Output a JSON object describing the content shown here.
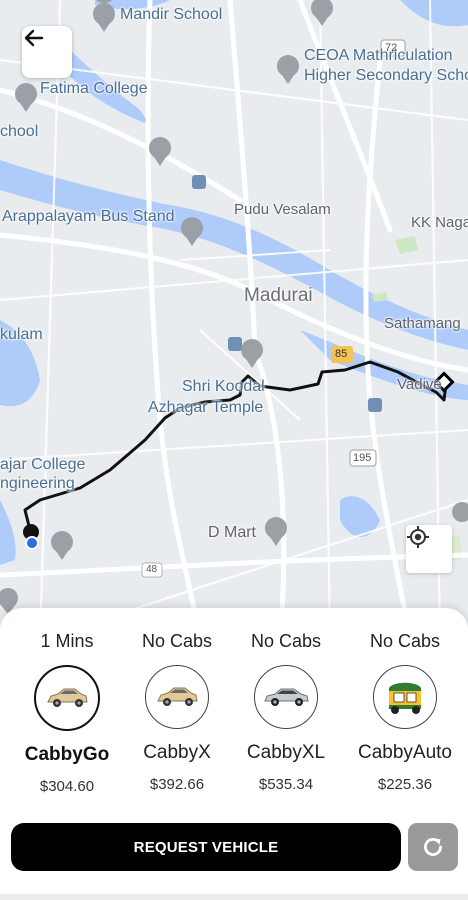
{
  "map": {
    "labels": {
      "mandir_school": "Mandir School",
      "ceoa_line1": "CEOA Mathriculation",
      "ceoa_line2": "Higher Secondary Scho",
      "fatima_college": "Fatima College",
      "school_left": "chool",
      "bus_stand": "Arappalayam Bus Stand",
      "pudu_vesalam": "Pudu Vesalam",
      "kk_nagar": "KK Naga",
      "madurai": "Madurai",
      "sathamangalam": "Sathamang",
      "kulam": "kulam",
      "temple_line1": "Shri Koodal",
      "temple_line2": "Azhagar Temple",
      "vadipatti": "Vadive",
      "college_line1": "ajar College",
      "college_line2": "ngineering",
      "d_mart": "D Mart",
      "road_72": "72",
      "road_85": "85",
      "road_195": "195",
      "road_48": "48"
    }
  },
  "header": {
    "back_icon": "arrow-left-icon"
  },
  "locate": {
    "icon": "my-location-icon"
  },
  "vehicles": [
    {
      "eta": "1 Mins",
      "name": "CabbyGo",
      "price": "$304.60",
      "selected": true,
      "icon": "beige-sedan-icon"
    },
    {
      "eta": "No Cabs",
      "name": "CabbyX",
      "price": "$392.66",
      "selected": false,
      "icon": "beige-sedan-icon"
    },
    {
      "eta": "No Cabs",
      "name": "CabbyXL",
      "price": "$535.34",
      "selected": false,
      "icon": "silver-sedan-icon"
    },
    {
      "eta": "No Cabs",
      "name": "CabbyAuto",
      "price": "$225.36",
      "selected": false,
      "icon": "auto-rickshaw-icon"
    }
  ],
  "actions": {
    "request_label": "REQUEST VEHICLE",
    "refresh_icon": "refresh-icon"
  },
  "colors": {
    "route": "#111111",
    "river": "#aecbfa",
    "map_background": "#e9ecef",
    "request_button": "#000000",
    "refresh_button": "#9a9a9a"
  }
}
